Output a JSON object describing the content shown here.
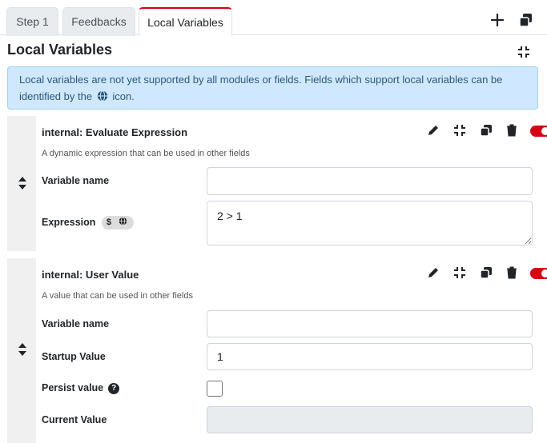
{
  "tabs": {
    "step": "Step 1",
    "feedbacks": "Feedbacks",
    "local_variables": "Local Variables"
  },
  "header": {
    "title": "Local Variables",
    "add_icon": "plus-icon",
    "copy_icon": "copy-icon"
  },
  "info": {
    "text_before": "Local variables are not yet supported by all modules or fields. Fields which support local variables can be identified by the",
    "text_after": "icon.",
    "icon": "globe-icon"
  },
  "blocks": [
    {
      "title": "internal: Evaluate Expression",
      "description": "A dynamic expression that can be used in other fields",
      "enabled": true,
      "fields": [
        {
          "label": "Variable name",
          "value": ""
        },
        {
          "label": "Expression",
          "value": "2 > 1",
          "badges": [
            "$",
            "globe-icon"
          ]
        }
      ]
    },
    {
      "title": "internal: User Value",
      "description": "A value that can be used in other fields",
      "enabled": true,
      "fields": [
        {
          "label": "Variable name",
          "value": ""
        },
        {
          "label": "Startup Value",
          "value": "1"
        },
        {
          "label": "Persist value",
          "checked": false,
          "help": "?"
        },
        {
          "label": "Current Value",
          "value": ""
        }
      ]
    }
  ],
  "colors": {
    "accent": "#d50215",
    "info_bg": "#cfe8ff",
    "info_text": "#2c5878"
  }
}
